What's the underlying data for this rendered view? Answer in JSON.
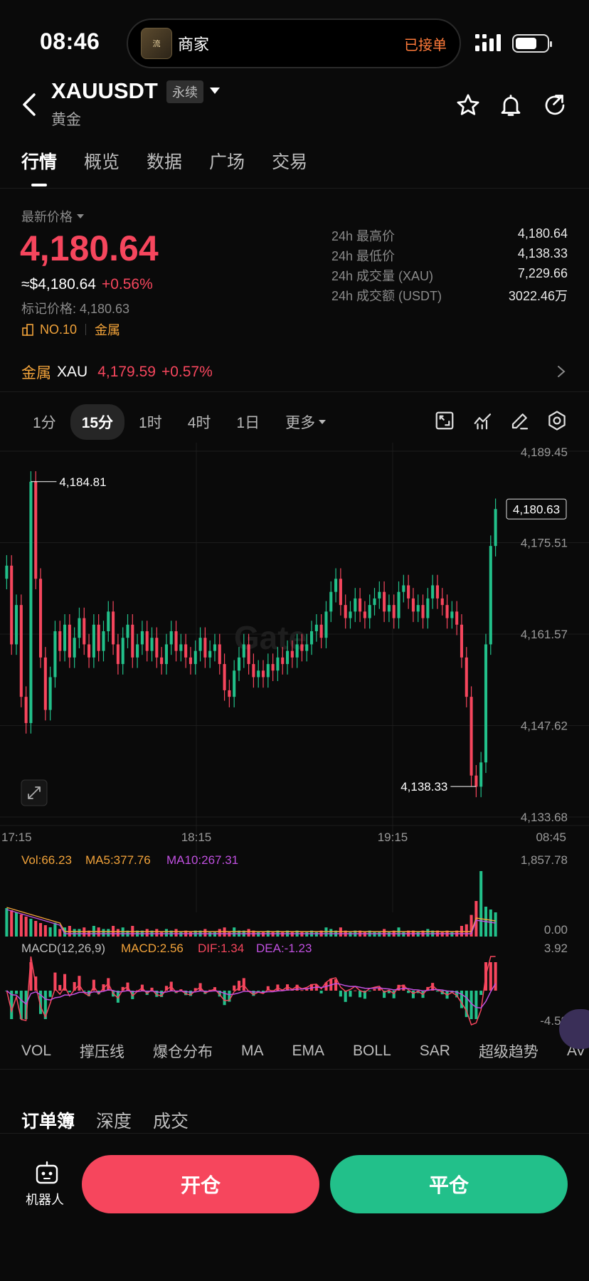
{
  "status_bar": {
    "time": "08:46",
    "island_thumb": "流\n娱",
    "merchant": "商家",
    "order_status": "已接单"
  },
  "header": {
    "symbol": "XAUUSDT",
    "badge": "永续",
    "subname": "黄金"
  },
  "tabs": [
    "行情",
    "概览",
    "数据",
    "广场",
    "交易"
  ],
  "ticker": {
    "last_label": "最新价格",
    "last_price": "4,180.64",
    "usd_price": "≈$4,180.64",
    "change_pct": "+0.56%",
    "mark_price": "标记价格: 4,180.63",
    "rank": "NO.10",
    "category": "金属",
    "stats": [
      {
        "label": "24h 最高价",
        "value": "4,180.64"
      },
      {
        "label": "24h 最低价",
        "value": "4,138.33"
      },
      {
        "label": "24h 成交量 (XAU)",
        "value": "7,229.66"
      },
      {
        "label": "24h 成交额 (USDT)",
        "value": "3022.46万"
      }
    ]
  },
  "metal": {
    "label": "金属",
    "symbol": "XAU",
    "price": "4,179.59",
    "change": "+0.57%"
  },
  "intervals": [
    "1分",
    "15分",
    "1时",
    "4时",
    "1日",
    "更多"
  ],
  "active_interval": "15分",
  "chart_data": {
    "type": "candlestick",
    "watermark": "Gate",
    "price_axis": [
      "4,189.45",
      "4,175.51",
      "4,161.57",
      "4,147.62",
      "4,133.68"
    ],
    "ylim": [
      4133.68,
      4189.45
    ],
    "time_axis": [
      "17:15",
      "18:15",
      "19:15",
      "08:45"
    ],
    "current_price_tag": "4,180.63",
    "high_marker": "4,184.81",
    "low_marker": "4,138.33",
    "close_series": [
      4172,
      4160,
      4166,
      4152,
      4148,
      4184.8,
      4170,
      4158,
      4150,
      4155,
      4162,
      4159,
      4163,
      4158,
      4161,
      4164,
      4160,
      4158,
      4163,
      4159,
      4162,
      4165,
      4160,
      4157,
      4161,
      4163,
      4158,
      4160,
      4162,
      4159,
      4161,
      4158,
      4157,
      4160,
      4162,
      4159,
      4160,
      4158,
      4157,
      4159,
      4161,
      4158,
      4159,
      4160,
      4157,
      4153,
      4152,
      4156,
      4158,
      4160,
      4157,
      4155,
      4156,
      4155,
      4157,
      4156,
      4158,
      4157,
      4159,
      4158,
      4160,
      4159,
      4160,
      4162,
      4163,
      4161,
      4165,
      4168,
      4170,
      4166,
      4164,
      4165,
      4167,
      4165,
      4164,
      4166,
      4167,
      4168,
      4165,
      4166,
      4164,
      4168,
      4169,
      4167,
      4165,
      4166,
      4164,
      4167,
      4169,
      4167,
      4166,
      4164,
      4165,
      4163,
      4158,
      4152,
      4140,
      4138.3,
      4142,
      4160,
      4175,
      4180.63
    ],
    "volume": {
      "label": "Vol:66.23",
      "ma5": "MA5:377.76",
      "ma10": "MA10:267.31",
      "axis_top": "1,857.78",
      "axis_bottom": "0.00"
    },
    "macd": {
      "label": "MACD(12,26,9)",
      "macd": "MACD:2.56",
      "dif": "DIF:1.34",
      "dea": "DEA:-1.23",
      "axis_top": "3.92",
      "axis_bottom": "-4.59"
    }
  },
  "indicators": [
    "VOL",
    "撑压线",
    "爆仓分布",
    "MA",
    "EMA",
    "BOLL",
    "SAR",
    "超级趋势",
    "AV"
  ],
  "orderbook_tabs": [
    "订单簿",
    "深度",
    "成交"
  ],
  "bottom": {
    "robot_label": "机器人",
    "open_label": "开仓",
    "close_label": "平仓"
  },
  "colors": {
    "up": "#22c08a",
    "down": "#f6465d",
    "accent": "#f2a33a",
    "ma10": "#c050e0"
  }
}
